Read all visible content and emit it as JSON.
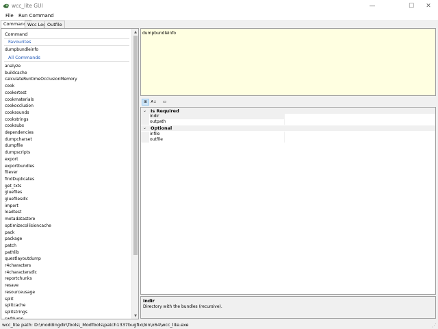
{
  "window": {
    "title": "wcc_lite GUI",
    "minimize_glyph": "—",
    "maximize_glyph": "☐",
    "close_glyph": "✕"
  },
  "menu": {
    "file": "File",
    "run_command": "Run Command"
  },
  "tabs": [
    {
      "label": "Commands",
      "active": true
    },
    {
      "label": "Wcc Log",
      "active": false
    },
    {
      "label": "Outfile",
      "active": false
    }
  ],
  "command_list": {
    "header": "Command",
    "favourites_title": "Favourites",
    "favourites": [
      "dumpbundleinfo"
    ],
    "all_title": "All Commands",
    "commands": [
      "analyze",
      "buildcache",
      "calculateRuntimeOcclusionMemory",
      "cook",
      "cookertest",
      "cookmaterials",
      "cookocclusion",
      "cooksounds",
      "cookstrings",
      "cooksubs",
      "dependencies",
      "dumpcharset",
      "dumpfile",
      "dumpscripts",
      "export",
      "exportbundles",
      "filever",
      "findDuplicates",
      "get_txts",
      "gluefiles",
      "gluefilesdlc",
      "import",
      "loadtest",
      "metadatastore",
      "optimizecollisioncache",
      "pack",
      "package",
      "patch",
      "pathlib",
      "questlayoutdump",
      "r4characters",
      "r4charactersdlc",
      "reportchunks",
      "resave",
      "resourceusage",
      "split",
      "splitcache",
      "splitstrings",
      "swfdump"
    ]
  },
  "command_preview": {
    "text": "dumpbundleinfo"
  },
  "property_toolbar": {
    "categorized_icon": "⊞",
    "alphabetical_icon": "A↓",
    "pages_icon": "▭"
  },
  "property_grid": {
    "categories": [
      {
        "label": "Is Required",
        "chevron": "⌄",
        "props": [
          "indir",
          "outpath"
        ]
      },
      {
        "label": "Optional",
        "chevron": "⌄",
        "props": [
          "infile",
          "outfile"
        ]
      }
    ]
  },
  "description": {
    "title": "indir",
    "text": "Directory with the bundles (recursive)."
  },
  "status": {
    "path": "wcc_lite path: D:\\moddingdir\\Tools\\_ModTools\\patch1337bugfix\\bin\\x64\\wcc_lite.exe",
    "grip": "⋰"
  },
  "scroll": {
    "up": "▲",
    "down": "▼"
  }
}
